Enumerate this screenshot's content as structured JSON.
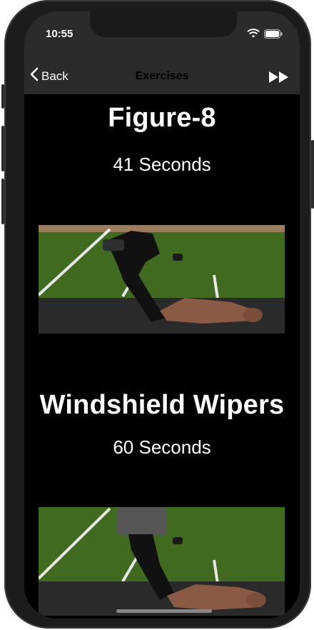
{
  "status": {
    "time": "10:55"
  },
  "nav": {
    "back_label": "Back",
    "title": "Exercises",
    "forward_icon": "fast-forward-icon"
  },
  "exercises": [
    {
      "title": "Figure-8",
      "duration": "41 Seconds"
    },
    {
      "title": "Windshield Wipers",
      "duration": "60 Seconds"
    }
  ],
  "colors": {
    "bar_bg": "#2b2b2d",
    "content_bg": "#000000",
    "text": "#ffffff"
  }
}
